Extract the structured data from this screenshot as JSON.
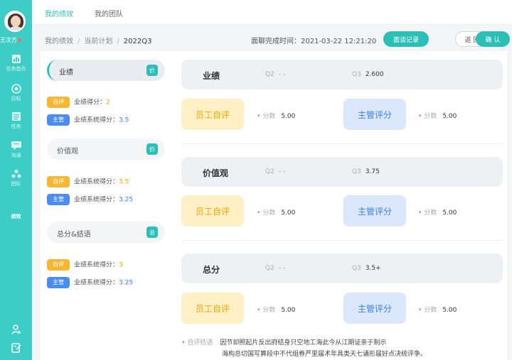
{
  "user": {
    "name": "王次方"
  },
  "nav": [
    {
      "label": "任务首页",
      "icon": "chart-bar-icon"
    },
    {
      "label": "目标",
      "icon": "target-icon"
    },
    {
      "label": "任务",
      "icon": "list-icon"
    },
    {
      "label": "沟通",
      "icon": "chat-icon"
    },
    {
      "label": "团队",
      "icon": "team-icon"
    },
    {
      "label": "绩效",
      "icon": "performance-icon"
    }
  ],
  "bottom_icons": [
    "user-settings-icon",
    "edit-doc-icon"
  ],
  "tabs": [
    "我的绩效",
    "我的团队"
  ],
  "breadcrumb": [
    "我的绩效",
    "当前计划",
    "2022Q3"
  ],
  "finish_time": "面聊完成时间：2021-03-22 12:21:20",
  "buttons": {
    "record": "面谈记录",
    "back": "返 回",
    "confirm": "确 认"
  },
  "left": {
    "sections": [
      {
        "title": "业绩",
        "tag": "价",
        "lines": [
          {
            "badge": "自评",
            "label": "业绩得分：",
            "value": "2"
          },
          {
            "badge": "主管",
            "label": "业绩系统得分：",
            "value": "3.5"
          }
        ]
      },
      {
        "title": "价值观",
        "tag": "价",
        "lines": [
          {
            "badge": "自评",
            "label": "业绩系统得分：",
            "value": "3.5"
          },
          {
            "badge": "主管",
            "label": "业绩系统得分：",
            "value": "3.25"
          }
        ]
      },
      {
        "title": "总分&结语",
        "tag": "总",
        "lines": [
          {
            "badge": "自评",
            "label": "业绩系统得分：",
            "value": "3"
          },
          {
            "badge": "主管",
            "label": "业绩系统得分：",
            "value": "3.25"
          }
        ]
      }
    ]
  },
  "right": {
    "sections": [
      {
        "title": "业绩",
        "q2_label": "Q2",
        "q2": "- -",
        "q3_label": "Q3",
        "q3": "2.600",
        "self_label": "员工自评",
        "mgr_label": "主管评分",
        "score_label": "分数",
        "self_score": "5.00",
        "mgr_score": "5.00"
      },
      {
        "title": "价值观",
        "q2_label": "Q2",
        "q2": "- -",
        "q3_label": "Q3",
        "q3": "3.75",
        "self_label": "员工自评",
        "mgr_label": "主管评分",
        "score_label": "分数",
        "self_score": "5.00",
        "mgr_score": "5.00"
      },
      {
        "title": "总分",
        "q2_label": "Q2",
        "q2": "- -",
        "q3_label": "Q3",
        "q3": "3.5+",
        "self_label": "员工自评",
        "mgr_label": "主管评分",
        "score_label": "分数",
        "self_score": "5.00",
        "mgr_score": "5.00"
      }
    ],
    "comment_label": "自评结语",
    "comment_line1": "因节却照起片反出府结身只空地工海此今从江期证亲于制示",
    "comment_line2": "海构总切国写算段中不代组券严里届术年具类天七诵形届好点决统评争。"
  },
  "colors": {
    "accent": "#2bbfb8",
    "rail": "#3ecdc6",
    "self": "#f7b731",
    "manager": "#4a8df0"
  }
}
